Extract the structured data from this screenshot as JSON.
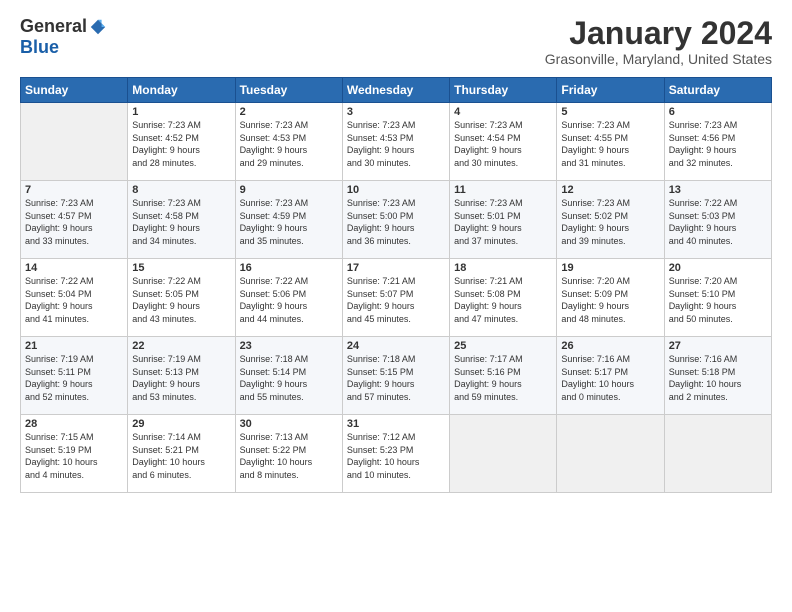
{
  "logo": {
    "general": "General",
    "blue": "Blue"
  },
  "header": {
    "title": "January 2024",
    "location": "Grasonville, Maryland, United States"
  },
  "weekdays": [
    "Sunday",
    "Monday",
    "Tuesday",
    "Wednesday",
    "Thursday",
    "Friday",
    "Saturday"
  ],
  "weeks": [
    [
      {
        "num": "",
        "info": ""
      },
      {
        "num": "1",
        "info": "Sunrise: 7:23 AM\nSunset: 4:52 PM\nDaylight: 9 hours\nand 28 minutes."
      },
      {
        "num": "2",
        "info": "Sunrise: 7:23 AM\nSunset: 4:53 PM\nDaylight: 9 hours\nand 29 minutes."
      },
      {
        "num": "3",
        "info": "Sunrise: 7:23 AM\nSunset: 4:53 PM\nDaylight: 9 hours\nand 30 minutes."
      },
      {
        "num": "4",
        "info": "Sunrise: 7:23 AM\nSunset: 4:54 PM\nDaylight: 9 hours\nand 30 minutes."
      },
      {
        "num": "5",
        "info": "Sunrise: 7:23 AM\nSunset: 4:55 PM\nDaylight: 9 hours\nand 31 minutes."
      },
      {
        "num": "6",
        "info": "Sunrise: 7:23 AM\nSunset: 4:56 PM\nDaylight: 9 hours\nand 32 minutes."
      }
    ],
    [
      {
        "num": "7",
        "info": "Sunrise: 7:23 AM\nSunset: 4:57 PM\nDaylight: 9 hours\nand 33 minutes."
      },
      {
        "num": "8",
        "info": "Sunrise: 7:23 AM\nSunset: 4:58 PM\nDaylight: 9 hours\nand 34 minutes."
      },
      {
        "num": "9",
        "info": "Sunrise: 7:23 AM\nSunset: 4:59 PM\nDaylight: 9 hours\nand 35 minutes."
      },
      {
        "num": "10",
        "info": "Sunrise: 7:23 AM\nSunset: 5:00 PM\nDaylight: 9 hours\nand 36 minutes."
      },
      {
        "num": "11",
        "info": "Sunrise: 7:23 AM\nSunset: 5:01 PM\nDaylight: 9 hours\nand 37 minutes."
      },
      {
        "num": "12",
        "info": "Sunrise: 7:23 AM\nSunset: 5:02 PM\nDaylight: 9 hours\nand 39 minutes."
      },
      {
        "num": "13",
        "info": "Sunrise: 7:22 AM\nSunset: 5:03 PM\nDaylight: 9 hours\nand 40 minutes."
      }
    ],
    [
      {
        "num": "14",
        "info": "Sunrise: 7:22 AM\nSunset: 5:04 PM\nDaylight: 9 hours\nand 41 minutes."
      },
      {
        "num": "15",
        "info": "Sunrise: 7:22 AM\nSunset: 5:05 PM\nDaylight: 9 hours\nand 43 minutes."
      },
      {
        "num": "16",
        "info": "Sunrise: 7:22 AM\nSunset: 5:06 PM\nDaylight: 9 hours\nand 44 minutes."
      },
      {
        "num": "17",
        "info": "Sunrise: 7:21 AM\nSunset: 5:07 PM\nDaylight: 9 hours\nand 45 minutes."
      },
      {
        "num": "18",
        "info": "Sunrise: 7:21 AM\nSunset: 5:08 PM\nDaylight: 9 hours\nand 47 minutes."
      },
      {
        "num": "19",
        "info": "Sunrise: 7:20 AM\nSunset: 5:09 PM\nDaylight: 9 hours\nand 48 minutes."
      },
      {
        "num": "20",
        "info": "Sunrise: 7:20 AM\nSunset: 5:10 PM\nDaylight: 9 hours\nand 50 minutes."
      }
    ],
    [
      {
        "num": "21",
        "info": "Sunrise: 7:19 AM\nSunset: 5:11 PM\nDaylight: 9 hours\nand 52 minutes."
      },
      {
        "num": "22",
        "info": "Sunrise: 7:19 AM\nSunset: 5:13 PM\nDaylight: 9 hours\nand 53 minutes."
      },
      {
        "num": "23",
        "info": "Sunrise: 7:18 AM\nSunset: 5:14 PM\nDaylight: 9 hours\nand 55 minutes."
      },
      {
        "num": "24",
        "info": "Sunrise: 7:18 AM\nSunset: 5:15 PM\nDaylight: 9 hours\nand 57 minutes."
      },
      {
        "num": "25",
        "info": "Sunrise: 7:17 AM\nSunset: 5:16 PM\nDaylight: 9 hours\nand 59 minutes."
      },
      {
        "num": "26",
        "info": "Sunrise: 7:16 AM\nSunset: 5:17 PM\nDaylight: 10 hours\nand 0 minutes."
      },
      {
        "num": "27",
        "info": "Sunrise: 7:16 AM\nSunset: 5:18 PM\nDaylight: 10 hours\nand 2 minutes."
      }
    ],
    [
      {
        "num": "28",
        "info": "Sunrise: 7:15 AM\nSunset: 5:19 PM\nDaylight: 10 hours\nand 4 minutes."
      },
      {
        "num": "29",
        "info": "Sunrise: 7:14 AM\nSunset: 5:21 PM\nDaylight: 10 hours\nand 6 minutes."
      },
      {
        "num": "30",
        "info": "Sunrise: 7:13 AM\nSunset: 5:22 PM\nDaylight: 10 hours\nand 8 minutes."
      },
      {
        "num": "31",
        "info": "Sunrise: 7:12 AM\nSunset: 5:23 PM\nDaylight: 10 hours\nand 10 minutes."
      },
      {
        "num": "",
        "info": ""
      },
      {
        "num": "",
        "info": ""
      },
      {
        "num": "",
        "info": ""
      }
    ]
  ]
}
